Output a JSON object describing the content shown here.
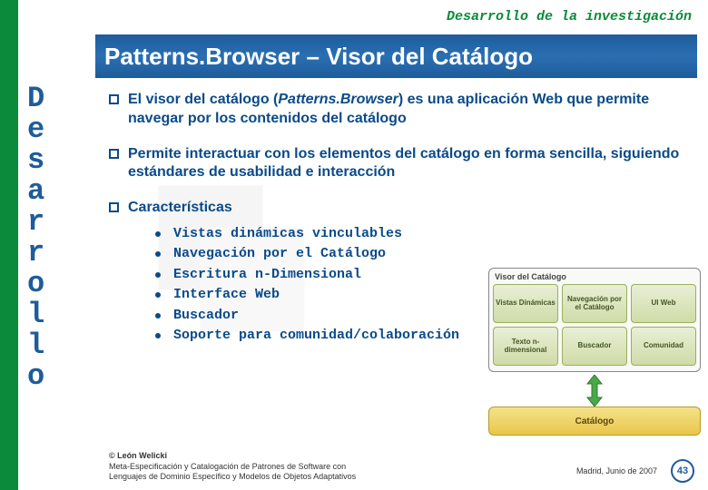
{
  "header": {
    "breadcrumb": "Desarrollo de la investigación"
  },
  "title": "Patterns.Browser – Visor del Catálogo",
  "sidebar": {
    "letters": [
      "D",
      "e",
      "s",
      "a",
      "r",
      "r",
      "o",
      "l",
      "l",
      "o"
    ]
  },
  "bullets": [
    {
      "prefix": "El visor del catálogo (",
      "italic": "Patterns.Browser",
      "suffix": ") es una aplicación Web que permite navegar por los contenidos del catálogo"
    },
    {
      "text": "Permite interactuar con los elementos del catálogo en forma sencilla, siguiendo estándares de usabilidad e interacción"
    },
    {
      "text": "Características",
      "sublist": [
        "Vistas dinámicas vinculables",
        "Navegación por el Catálogo",
        "Escritura n-Dimensional",
        "Interface Web",
        "Buscador",
        "Soporte para comunidad/colaboración"
      ]
    }
  ],
  "diagram": {
    "group_title": "Visor del Catálogo",
    "cells": [
      "Vistas Dinámicas",
      "Navegación por el Catálogo",
      "UI Web",
      "Texto n-dimensional",
      "Buscador",
      "Comunidad"
    ],
    "bottom_label": "Catálogo"
  },
  "footer": {
    "copyright": "© León Welicki",
    "line2": "Meta-Especificación y Catalogación de Patrones de Software con",
    "line3": "Lenguajes de Dominio Específico y Modelos de Objetos Adaptativos",
    "location_date": "Madrid, Junio de 2007",
    "page": "43"
  }
}
